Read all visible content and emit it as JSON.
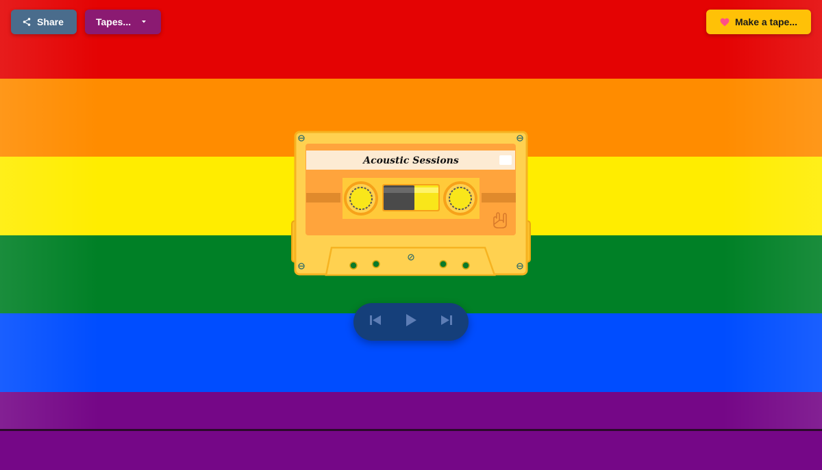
{
  "header": {
    "share_label": "Share",
    "tapes_label": "Tapes...",
    "make_tape_label": "Make a tape..."
  },
  "cassette": {
    "title": "Acoustic Sessions",
    "body_color": "#ffd150",
    "label_color": "#ffa43c",
    "title_strip_color": "#fdebd3"
  },
  "player": {
    "controls": [
      "previous-icon",
      "play-icon",
      "next-icon"
    ]
  },
  "flag": {
    "colors": [
      "#e40303",
      "#ff8c00",
      "#ffed00",
      "#008026",
      "#004dff",
      "#750787"
    ]
  },
  "icons": {
    "share": "share-icon",
    "tapes_caret": "caret-down-icon",
    "make_tape": "heart-icon",
    "cassette_corner": "rock-hand-icon"
  }
}
